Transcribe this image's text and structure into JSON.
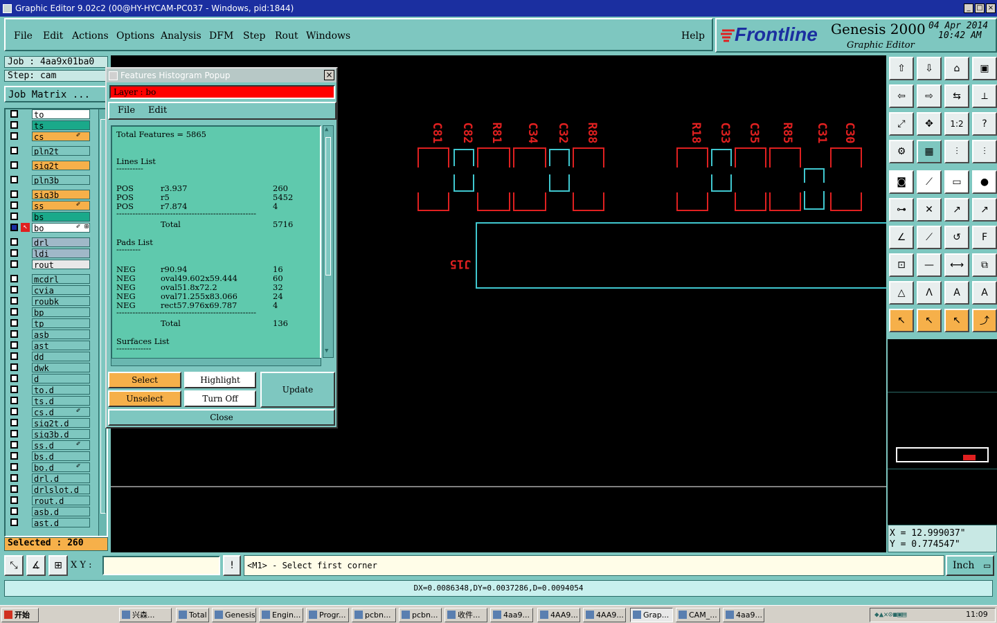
{
  "window": {
    "title": "Graphic Editor 9.02c2 (00@HY-HYCAM-PC037 - Windows, pid:1844)"
  },
  "menu": {
    "items": [
      "File",
      "Edit",
      "Actions",
      "Options",
      "Analysis",
      "DFM",
      "Step",
      "Rout",
      "Windows"
    ],
    "help": "Help"
  },
  "brand": {
    "logo": "Frontline",
    "product": "Genesis 2000",
    "subtitle": "Graphic Editor",
    "date": "04 Apr 2014",
    "time": "10:42 AM"
  },
  "left": {
    "job": "Job : 4aa9x01ba0",
    "step": "Step: cam",
    "job_matrix": "Job Matrix ...",
    "selected": "Selected : 260",
    "layers": [
      {
        "name": "to",
        "color": "#ffffff"
      },
      {
        "name": "ts",
        "color": "#1aa98a"
      },
      {
        "name": "cs",
        "color": "#f6b04a",
        "edit": "✐"
      },
      {
        "name": "pln2t",
        "color": "#7ec7c0"
      },
      {
        "name": "sig2t",
        "color": "#f6b04a"
      },
      {
        "name": "pln3b",
        "color": "#7ec7c0"
      },
      {
        "name": "sig3b",
        "color": "#f6b04a"
      },
      {
        "name": "ss",
        "color": "#f6b04a",
        "edit": "✐"
      },
      {
        "name": "bs",
        "color": "#1aa98a"
      },
      {
        "name": "bo",
        "color": "#ffffff",
        "edit": "✐ ⊞",
        "active": true
      },
      {
        "name": "drl",
        "color": "#a0b8c8"
      },
      {
        "name": "ldi",
        "color": "#a0b8c8"
      },
      {
        "name": "rout",
        "color": "#e8e8e8"
      },
      {
        "name": "mcdrl",
        "color": "#7ec7c0"
      },
      {
        "name": "cvia",
        "color": "#7ec7c0"
      },
      {
        "name": "roubk",
        "color": "#7ec7c0"
      },
      {
        "name": "bp",
        "color": "#7ec7c0"
      },
      {
        "name": "tp",
        "color": "#7ec7c0"
      },
      {
        "name": "asb",
        "color": "#7ec7c0"
      },
      {
        "name": "ast",
        "color": "#7ec7c0"
      },
      {
        "name": "dd",
        "color": "#7ec7c0"
      },
      {
        "name": "dwk",
        "color": "#7ec7c0"
      },
      {
        "name": "d",
        "color": "#7ec7c0"
      },
      {
        "name": "to.d",
        "color": "#7ec7c0"
      },
      {
        "name": "ts.d",
        "color": "#7ec7c0"
      },
      {
        "name": "cs.d",
        "color": "#7ec7c0",
        "edit": "✐"
      },
      {
        "name": "sig2t.d",
        "color": "#7ec7c0"
      },
      {
        "name": "sig3b.d",
        "color": "#7ec7c0"
      },
      {
        "name": "ss.d",
        "color": "#7ec7c0",
        "edit": "✐"
      },
      {
        "name": "bs.d",
        "color": "#7ec7c0"
      },
      {
        "name": "bo.d",
        "color": "#7ec7c0",
        "edit": "✐"
      },
      {
        "name": "drl.d",
        "color": "#7ec7c0"
      },
      {
        "name": "drlslot.d",
        "color": "#7ec7c0"
      },
      {
        "name": "rout.d",
        "color": "#7ec7c0"
      },
      {
        "name": "asb.d",
        "color": "#7ec7c0"
      },
      {
        "name": "ast.d",
        "color": "#7ec7c0"
      }
    ]
  },
  "popup": {
    "title": "Features Histogram Popup",
    "layer": "Layer :  bo",
    "menu": [
      "File",
      "Edit"
    ],
    "total_features": "Total Features = 5865",
    "lines_header": "Lines List",
    "lines": [
      {
        "pol": "POS",
        "sym": "r3.937",
        "count": "260"
      },
      {
        "pol": "POS",
        "sym": "r5",
        "count": "5452"
      },
      {
        "pol": "POS",
        "sym": "r7.874",
        "count": "4"
      }
    ],
    "lines_total_label": "Total",
    "lines_total": "5716",
    "pads_header": "Pads List",
    "pads": [
      {
        "pol": "NEG",
        "sym": "r90.94",
        "count": "16"
      },
      {
        "pol": "NEG",
        "sym": "oval49.602x59.444",
        "count": "60"
      },
      {
        "pol": "NEG",
        "sym": "oval51.8x72.2",
        "count": "32"
      },
      {
        "pol": "NEG",
        "sym": "oval71.255x83.066",
        "count": "24"
      },
      {
        "pol": "NEG",
        "sym": "rect57.976x69.787",
        "count": "4"
      }
    ],
    "pads_total_label": "Total",
    "pads_total": "136",
    "surfaces_header": "Surfaces List",
    "buttons": {
      "select": "Select",
      "highlight": "Highlight",
      "update": "Update",
      "unselect": "Unselect",
      "turn_off": "Turn Off",
      "close": "Close"
    }
  },
  "canvas": {
    "labels_top": [
      "C81",
      "C82",
      "R81",
      "C34",
      "C32",
      "R88",
      "R18",
      "C33",
      "C35",
      "R85",
      "C31",
      "C30"
    ],
    "ref_label": "J15",
    "colors": {
      "red": "#e02020",
      "cyan": "#40c8d0",
      "white": "#ffffff"
    }
  },
  "coords": {
    "x": "X = 12.999037\"",
    "y": "Y = 0.774547\""
  },
  "statusbar": {
    "xy_label": "X Y :",
    "xy_value": "",
    "prompt": "<M1> - Select first corner",
    "units": "Inch"
  },
  "info": "DX=0.0086348,DY=0.0037286,D=0.0094054",
  "taskbar": {
    "start": "开始",
    "tasks": [
      "兴森...",
      "Total ...",
      "Genesis",
      "Engin...",
      "Progr...",
      "pcbn...",
      "pcbn...",
      "收件...",
      "4aa9...",
      "4AA9...",
      "4AA9...",
      "Grap...",
      "CAM_...",
      "4aa9..."
    ],
    "clock": "11:09"
  }
}
